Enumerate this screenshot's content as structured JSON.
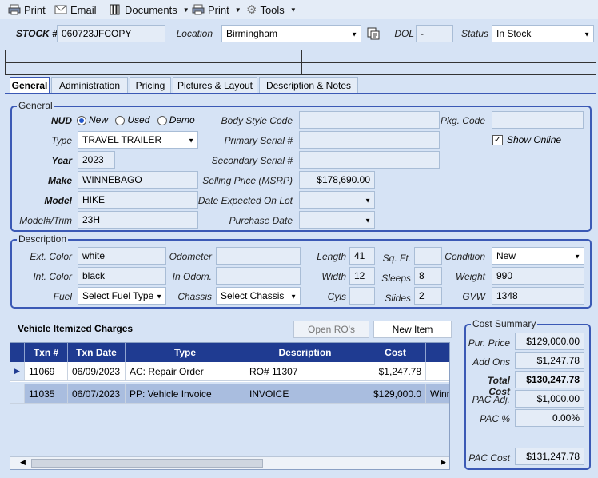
{
  "toolbar": {
    "print1": "Print",
    "email": "Email",
    "documents": "Documents",
    "print2": "Print",
    "tools": "Tools"
  },
  "header": {
    "stock_label": "STOCK #",
    "stock_value": "060723JFCOPY",
    "location_label": "Location",
    "location_value": "Birmingham",
    "dol_label": "DOL",
    "dol_value": "-",
    "status_label": "Status",
    "status_value": "In Stock"
  },
  "tabs": [
    "General",
    "Administration",
    "Pricing",
    "Pictures & Layout",
    "Description & Notes"
  ],
  "general": {
    "title": "General",
    "nud_label": "NUD",
    "nud_options": [
      "New",
      "Used",
      "Demo"
    ],
    "nud_selected": "New",
    "type_label": "Type",
    "type_value": "TRAVEL TRAILER",
    "year_label": "Year",
    "year_value": "2023",
    "make_label": "Make",
    "make_value": "WINNEBAGO",
    "model_label": "Model",
    "model_value": "HIKE",
    "trim_label": "Model#/Trim",
    "trim_value": "23H",
    "body_label": "Body Style Code",
    "body_value": "",
    "primary_label": "Primary Serial #",
    "primary_value": "",
    "secondary_label": "Secondary Serial #",
    "secondary_value": "",
    "msrp_label": "Selling Price (MSRP)",
    "msrp_value": "$178,690.00",
    "expected_label": "Date Expected On Lot",
    "expected_value": "",
    "purchase_label": "Purchase Date",
    "purchase_value": "",
    "pkg_label": "Pkg. Code",
    "pkg_value": "",
    "show_online_label": "Show Online",
    "show_online_checked": true
  },
  "description": {
    "title": "Description",
    "ext_label": "Ext. Color",
    "ext_value": "white",
    "int_label": "Int. Color",
    "int_value": "black",
    "fuel_label": "Fuel",
    "fuel_value": "Select Fuel Type",
    "odo_label": "Odometer",
    "odo_value": "",
    "inodo_label": "In Odom.",
    "inodo_value": "",
    "chassis_label": "Chassis",
    "chassis_value": "Select Chassis",
    "length_label": "Length",
    "length_value": "41",
    "width_label": "Width",
    "width_value": "12",
    "cyls_label": "Cyls",
    "cyls_value": "",
    "sqft_label": "Sq. Ft.",
    "sqft_value": "",
    "sleeps_label": "Sleeps",
    "sleeps_value": "8",
    "slides_label": "Slides",
    "slides_value": "2",
    "condition_label": "Condition",
    "condition_value": "New",
    "weight_label": "Weight",
    "weight_value": "990",
    "gvw_label": "GVW",
    "gvw_value": "1348"
  },
  "charges": {
    "title": "Vehicle Itemized Charges",
    "open_ro": "Open RO's",
    "new_item": "New Item",
    "columns": [
      "Txn #",
      "Txn Date",
      "Type",
      "Description",
      "Cost"
    ],
    "rows": [
      {
        "txn": "11069",
        "date": "06/09/2023",
        "type": "AC: Repair Order",
        "desc": "RO# 11307",
        "cost": "$1,247.78",
        "extra": ""
      },
      {
        "txn": "11035",
        "date": "06/07/2023",
        "type": "PP: Vehicle Invoice",
        "desc": "INVOICE",
        "cost": "$129,000.0",
        "extra": "Winn"
      }
    ]
  },
  "cost_summary": {
    "title": "Cost Summary",
    "pur_label": "Pur. Price",
    "pur_value": "$129,000.00",
    "addons_label": "Add Ons",
    "addons_value": "$1,247.78",
    "total_label": "Total Cost",
    "total_value": "$130,247.78",
    "pac_adj_label": "PAC Adj.",
    "pac_adj_value": "$1,000.00",
    "pac_pct_label": "PAC %",
    "pac_pct_value": "0.00%",
    "pac_cost_label": "PAC Cost",
    "pac_cost_value": "$131,247.78"
  }
}
